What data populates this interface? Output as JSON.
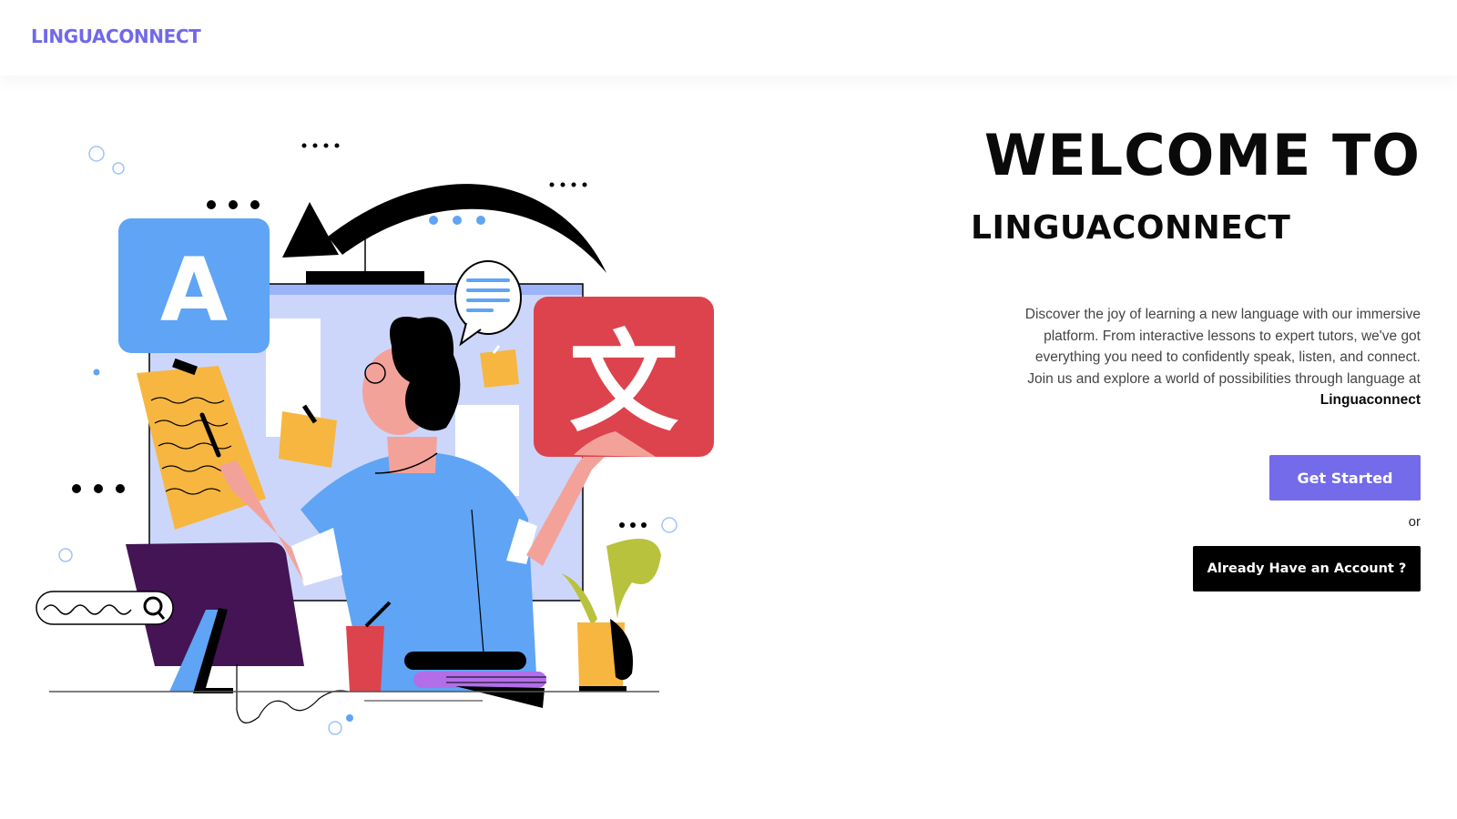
{
  "brand": {
    "name": "LINGUACONNECT",
    "color": "#7168e8"
  },
  "hero": {
    "title_line1": "WELCOME TO",
    "title_line2": "LINGUACONNECT",
    "description_text": "Discover the joy of learning a new language with our immersive platform. From interactive lessons to expert tutors, we've got everything you need to confidently speak, listen, and connect. Join us and explore a world of possibilities through language at",
    "description_brand": "Linguaconnect",
    "primary_button_label": "Get Started",
    "or_label": "or",
    "secondary_button_label": "Already Have an Account ?"
  },
  "illustration": {
    "letter_a": "A",
    "glyph_wen": "文"
  },
  "colors": {
    "accent": "#736be9",
    "dark": "#000000",
    "illustration_blue": "#5fa4f5",
    "illustration_red": "#dd434d",
    "illustration_yellow": "#f7b640",
    "illustration_purple": "#441454"
  }
}
